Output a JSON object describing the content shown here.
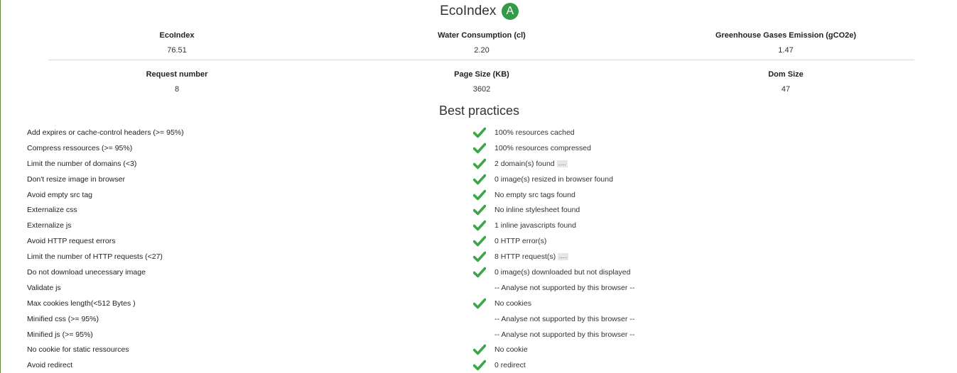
{
  "header": {
    "title": "EcoIndex",
    "grade": "A",
    "grade_color": "#349a47"
  },
  "metrics": {
    "ecoindex": {
      "label": "EcoIndex",
      "value": "76.51"
    },
    "water": {
      "label": "Water Consumption (cl)",
      "value": "2.20"
    },
    "ghg": {
      "label": "Greenhouse Gases Emission (gCO2e)",
      "value": "1.47"
    },
    "requests": {
      "label": "Request number",
      "value": "8"
    },
    "page_size": {
      "label": "Page Size (KB)",
      "value": "3602"
    },
    "dom_size": {
      "label": "Dom Size",
      "value": "47"
    }
  },
  "best_practices": {
    "title": "Best practices",
    "check_color": "#3ea64a",
    "items": [
      {
        "name": "Add expires or cache-control headers (>= 95%)",
        "result": "100% resources cached",
        "passed": true,
        "details": ""
      },
      {
        "name": "Compress ressources (>= 95%)",
        "result": "100% resources compressed",
        "passed": true,
        "details": ""
      },
      {
        "name": "Limit the number of domains (<3)",
        "result": "2 domain(s) found",
        "passed": true,
        "details": "....."
      },
      {
        "name": "Don't resize image in browser",
        "result": "0 image(s) resized in browser found",
        "passed": true,
        "details": ""
      },
      {
        "name": "Avoid empty src tag",
        "result": "No empty src tags found",
        "passed": true,
        "details": ""
      },
      {
        "name": "Externalize css",
        "result": "No inline stylesheet found",
        "passed": true,
        "details": ""
      },
      {
        "name": "Externalize js",
        "result": "1 inline javascripts found",
        "passed": true,
        "details": ""
      },
      {
        "name": "Avoid HTTP request errors",
        "result": "0 HTTP error(s)",
        "passed": true,
        "details": ""
      },
      {
        "name": "Limit the number of HTTP requests (<27)",
        "result": "8 HTTP request(s)",
        "passed": true,
        "details": "....."
      },
      {
        "name": "Do not download unecessary image",
        "result": "0 image(s) downloaded but not displayed",
        "passed": true,
        "details": ""
      },
      {
        "name": "Validate js",
        "result": "-- Analyse not supported by this browser --",
        "passed": false,
        "details": ""
      },
      {
        "name": "Max cookies length(<512 Bytes )",
        "result": "No cookies",
        "passed": true,
        "details": ""
      },
      {
        "name": "Minified css (>= 95%)",
        "result": "-- Analyse not supported by this browser --",
        "passed": false,
        "details": ""
      },
      {
        "name": "Minified js (>= 95%)",
        "result": "-- Analyse not supported by this browser --",
        "passed": false,
        "details": ""
      },
      {
        "name": "No cookie for static ressources",
        "result": "No cookie",
        "passed": true,
        "details": ""
      },
      {
        "name": "Avoid redirect",
        "result": "0 redirect",
        "passed": true,
        "details": ""
      }
    ]
  }
}
